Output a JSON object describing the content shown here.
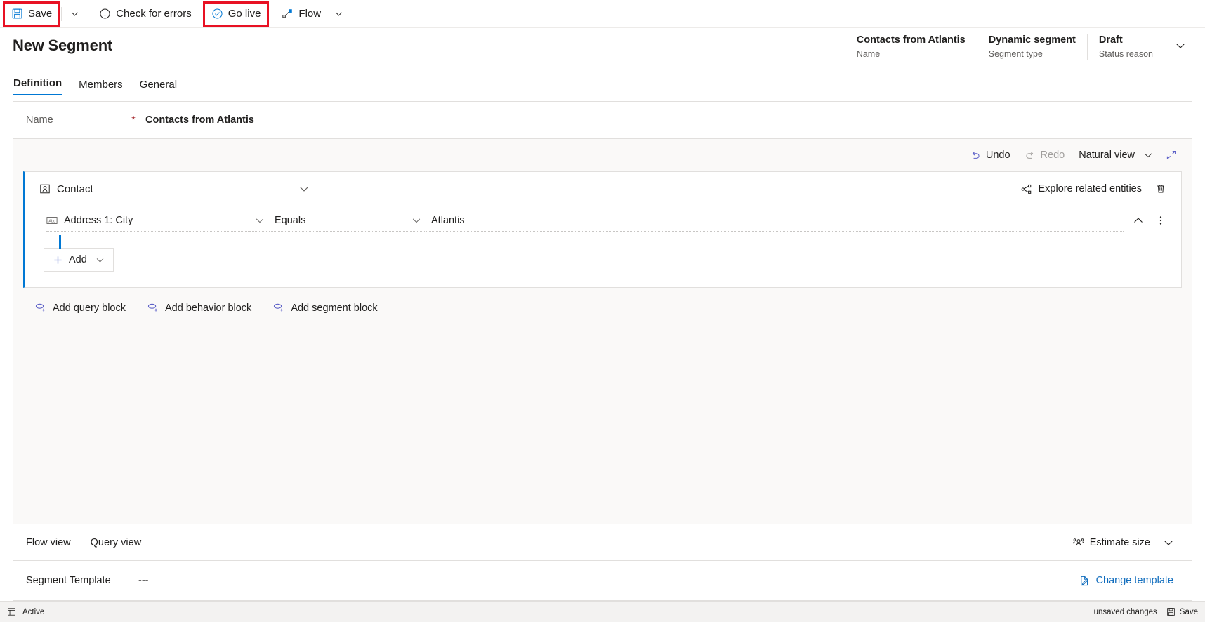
{
  "commandbar": {
    "save": {
      "label": "Save",
      "icon": "save-icon",
      "highlighted": true
    },
    "save_caret_icon": "chevron-down-icon",
    "check_errors": {
      "label": "Check for errors",
      "icon": "error-circle-icon"
    },
    "go_live": {
      "label": "Go live",
      "icon": "check-circle-icon",
      "highlighted": true
    },
    "flow": {
      "label": "Flow",
      "icon": "flow-icon"
    },
    "flow_caret_icon": "chevron-down-icon"
  },
  "header": {
    "title": "New Segment",
    "meta": [
      {
        "value": "Contacts from Atlantis",
        "label": "Name"
      },
      {
        "value": "Dynamic segment",
        "label": "Segment type"
      },
      {
        "value": "Draft",
        "label": "Status reason"
      }
    ],
    "expand_icon": "chevron-down-icon"
  },
  "tabs": [
    {
      "label": "Definition",
      "active": true
    },
    {
      "label": "Members",
      "active": false
    },
    {
      "label": "General",
      "active": false
    }
  ],
  "form": {
    "name_label": "Name",
    "required_marker": "*",
    "name_value": "Contacts from Atlantis"
  },
  "designer": {
    "toolbar": {
      "undo": {
        "label": "Undo",
        "icon": "undo-icon",
        "disabled": false
      },
      "redo": {
        "label": "Redo",
        "icon": "redo-icon",
        "disabled": true
      },
      "view_mode": {
        "label": "Natural view",
        "caret_icon": "chevron-down-icon"
      },
      "expand_icon": "expand-diagonal-icon"
    },
    "query_block": {
      "entity": "Contact",
      "entity_icon": "contact-entity-icon",
      "collapse_icon": "chevron-down-icon",
      "explore_related": {
        "label": "Explore related entities",
        "icon": "related-entities-icon"
      },
      "delete_icon": "trash-icon",
      "condition": {
        "field": "Address 1: City",
        "field_icon": "text-field-icon",
        "field_caret_icon": "chevron-down-icon",
        "operator": "Equals",
        "operator_caret_icon": "chevron-down-icon",
        "value": "Atlantis",
        "collapse_icon": "chevron-up-icon",
        "more_icon": "more-vertical-icon"
      },
      "add_button": {
        "label": "Add",
        "icon": "plus-icon",
        "caret_icon": "chevron-down-icon"
      }
    },
    "block_links": [
      {
        "label": "Add query block",
        "icon": "add-block-icon"
      },
      {
        "label": "Add behavior block",
        "icon": "add-block-icon"
      },
      {
        "label": "Add segment block",
        "icon": "add-block-icon"
      }
    ]
  },
  "footer": {
    "views": [
      {
        "label": "Flow view"
      },
      {
        "label": "Query view"
      }
    ],
    "estimate_size": {
      "label": "Estimate size",
      "icon": "people-icon",
      "caret_icon": "chevron-down-icon"
    },
    "template_label": "Segment Template",
    "template_value": "---",
    "change_template": {
      "label": "Change template",
      "icon": "document-edit-icon"
    }
  },
  "statusbar": {
    "form_icon": "form-icon",
    "state": "Active",
    "unsaved": "unsaved changes",
    "save": {
      "label": "Save",
      "icon": "save-icon"
    }
  },
  "colors": {
    "accent": "#0078d4",
    "link": "#0f6cbd",
    "highlight": "#e81123",
    "required": "#a4262c",
    "surface": "#faf9f8",
    "border": "#e1dfdd",
    "disabled": "#a19f9d"
  }
}
